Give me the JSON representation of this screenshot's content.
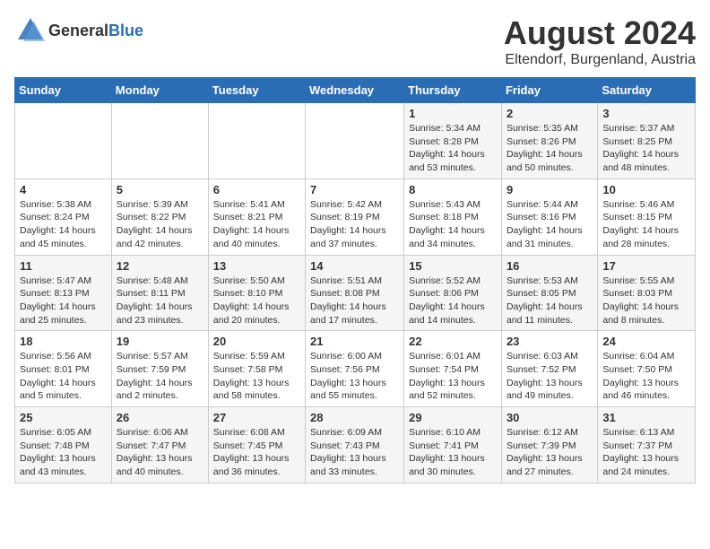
{
  "logo": {
    "general": "General",
    "blue": "Blue"
  },
  "title": "August 2024",
  "location": "Eltendorf, Burgenland, Austria",
  "days_of_week": [
    "Sunday",
    "Monday",
    "Tuesday",
    "Wednesday",
    "Thursday",
    "Friday",
    "Saturday"
  ],
  "weeks": [
    [
      {
        "day": "",
        "info": ""
      },
      {
        "day": "",
        "info": ""
      },
      {
        "day": "",
        "info": ""
      },
      {
        "day": "",
        "info": ""
      },
      {
        "day": "1",
        "info": "Sunrise: 5:34 AM\nSunset: 8:28 PM\nDaylight: 14 hours\nand 53 minutes."
      },
      {
        "day": "2",
        "info": "Sunrise: 5:35 AM\nSunset: 8:26 PM\nDaylight: 14 hours\nand 50 minutes."
      },
      {
        "day": "3",
        "info": "Sunrise: 5:37 AM\nSunset: 8:25 PM\nDaylight: 14 hours\nand 48 minutes."
      }
    ],
    [
      {
        "day": "4",
        "info": "Sunrise: 5:38 AM\nSunset: 8:24 PM\nDaylight: 14 hours\nand 45 minutes."
      },
      {
        "day": "5",
        "info": "Sunrise: 5:39 AM\nSunset: 8:22 PM\nDaylight: 14 hours\nand 42 minutes."
      },
      {
        "day": "6",
        "info": "Sunrise: 5:41 AM\nSunset: 8:21 PM\nDaylight: 14 hours\nand 40 minutes."
      },
      {
        "day": "7",
        "info": "Sunrise: 5:42 AM\nSunset: 8:19 PM\nDaylight: 14 hours\nand 37 minutes."
      },
      {
        "day": "8",
        "info": "Sunrise: 5:43 AM\nSunset: 8:18 PM\nDaylight: 14 hours\nand 34 minutes."
      },
      {
        "day": "9",
        "info": "Sunrise: 5:44 AM\nSunset: 8:16 PM\nDaylight: 14 hours\nand 31 minutes."
      },
      {
        "day": "10",
        "info": "Sunrise: 5:46 AM\nSunset: 8:15 PM\nDaylight: 14 hours\nand 28 minutes."
      }
    ],
    [
      {
        "day": "11",
        "info": "Sunrise: 5:47 AM\nSunset: 8:13 PM\nDaylight: 14 hours\nand 25 minutes."
      },
      {
        "day": "12",
        "info": "Sunrise: 5:48 AM\nSunset: 8:11 PM\nDaylight: 14 hours\nand 23 minutes."
      },
      {
        "day": "13",
        "info": "Sunrise: 5:50 AM\nSunset: 8:10 PM\nDaylight: 14 hours\nand 20 minutes."
      },
      {
        "day": "14",
        "info": "Sunrise: 5:51 AM\nSunset: 8:08 PM\nDaylight: 14 hours\nand 17 minutes."
      },
      {
        "day": "15",
        "info": "Sunrise: 5:52 AM\nSunset: 8:06 PM\nDaylight: 14 hours\nand 14 minutes."
      },
      {
        "day": "16",
        "info": "Sunrise: 5:53 AM\nSunset: 8:05 PM\nDaylight: 14 hours\nand 11 minutes."
      },
      {
        "day": "17",
        "info": "Sunrise: 5:55 AM\nSunset: 8:03 PM\nDaylight: 14 hours\nand 8 minutes."
      }
    ],
    [
      {
        "day": "18",
        "info": "Sunrise: 5:56 AM\nSunset: 8:01 PM\nDaylight: 14 hours\nand 5 minutes."
      },
      {
        "day": "19",
        "info": "Sunrise: 5:57 AM\nSunset: 7:59 PM\nDaylight: 14 hours\nand 2 minutes."
      },
      {
        "day": "20",
        "info": "Sunrise: 5:59 AM\nSunset: 7:58 PM\nDaylight: 13 hours\nand 58 minutes."
      },
      {
        "day": "21",
        "info": "Sunrise: 6:00 AM\nSunset: 7:56 PM\nDaylight: 13 hours\nand 55 minutes."
      },
      {
        "day": "22",
        "info": "Sunrise: 6:01 AM\nSunset: 7:54 PM\nDaylight: 13 hours\nand 52 minutes."
      },
      {
        "day": "23",
        "info": "Sunrise: 6:03 AM\nSunset: 7:52 PM\nDaylight: 13 hours\nand 49 minutes."
      },
      {
        "day": "24",
        "info": "Sunrise: 6:04 AM\nSunset: 7:50 PM\nDaylight: 13 hours\nand 46 minutes."
      }
    ],
    [
      {
        "day": "25",
        "info": "Sunrise: 6:05 AM\nSunset: 7:48 PM\nDaylight: 13 hours\nand 43 minutes."
      },
      {
        "day": "26",
        "info": "Sunrise: 6:06 AM\nSunset: 7:47 PM\nDaylight: 13 hours\nand 40 minutes."
      },
      {
        "day": "27",
        "info": "Sunrise: 6:08 AM\nSunset: 7:45 PM\nDaylight: 13 hours\nand 36 minutes."
      },
      {
        "day": "28",
        "info": "Sunrise: 6:09 AM\nSunset: 7:43 PM\nDaylight: 13 hours\nand 33 minutes."
      },
      {
        "day": "29",
        "info": "Sunrise: 6:10 AM\nSunset: 7:41 PM\nDaylight: 13 hours\nand 30 minutes."
      },
      {
        "day": "30",
        "info": "Sunrise: 6:12 AM\nSunset: 7:39 PM\nDaylight: 13 hours\nand 27 minutes."
      },
      {
        "day": "31",
        "info": "Sunrise: 6:13 AM\nSunset: 7:37 PM\nDaylight: 13 hours\nand 24 minutes."
      }
    ]
  ]
}
